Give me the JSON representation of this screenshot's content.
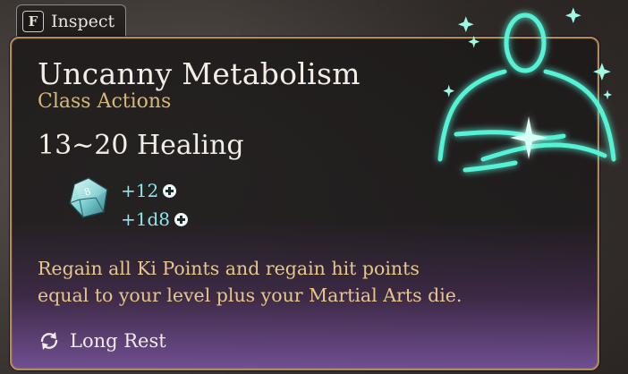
{
  "inspect": {
    "key": "F",
    "label": "Inspect"
  },
  "action": {
    "title": "Uncanny Metabolism",
    "category": "Class Actions",
    "healing": "13~20 Healing",
    "bonuses": [
      "+12",
      "+1d8"
    ],
    "die_face": "8",
    "description_lines": [
      "Regain all Ki Points and regain hit points",
      "equal to your level plus your Martial Arts die."
    ],
    "cooldown": "Long Rest"
  },
  "colors": {
    "title": "#f3ede6",
    "category": "#d8b777",
    "bonus": "#8fe6ea",
    "description": "#e6c689",
    "border": "#b38a5e",
    "glow": "#4ff0d2"
  },
  "icons": {
    "inspect_key": "keyboard-key-icon",
    "die": "d8-die-icon",
    "bonus": "plus-circle-icon",
    "cooldown": "refresh-cycle-icon",
    "figure": "glowing-monk-meditation-icon"
  }
}
